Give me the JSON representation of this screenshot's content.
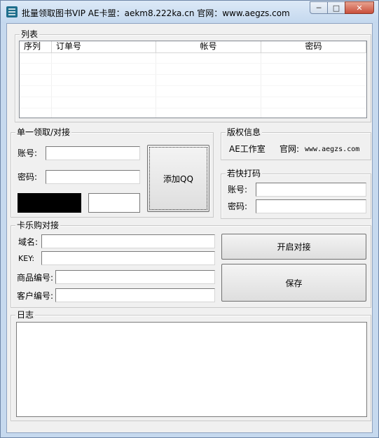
{
  "window": {
    "title": "批量领取图书VIP  AE卡盟：aekm8.222ka.cn  官网：www.aegzs.com",
    "min_symbol": "─",
    "max_symbol": "□",
    "close_symbol": "✕"
  },
  "list_group": {
    "title": "列表",
    "columns": [
      "序列",
      "订单号",
      "帐号",
      "密码"
    ]
  },
  "single_group": {
    "title": "单一领取/对接",
    "account_label": "账号:",
    "account_value": "",
    "password_label": "密码:",
    "password_value": "",
    "add_qq_label": "添加QQ"
  },
  "copyright_group": {
    "title": "版权信息",
    "studio": "AE工作室",
    "site_label": "官网:",
    "site_value": "www.aegzs.com"
  },
  "captcha_group": {
    "title": "若快打码",
    "account_label": "账号:",
    "password_label": "密码:"
  },
  "kalegou_group": {
    "title": "卡乐购对接",
    "domain_label": "域名:",
    "key_label": "KEY:",
    "product_label": "商品编号:",
    "customer_label": "客户编号:",
    "start_button": "开启对接",
    "save_button": "保存"
  },
  "log_group": {
    "title": "日志"
  },
  "colors": {
    "titlebar": "#c4d8ee",
    "client_bg": "#f0f0f0",
    "close_button": "#c94f3b"
  }
}
